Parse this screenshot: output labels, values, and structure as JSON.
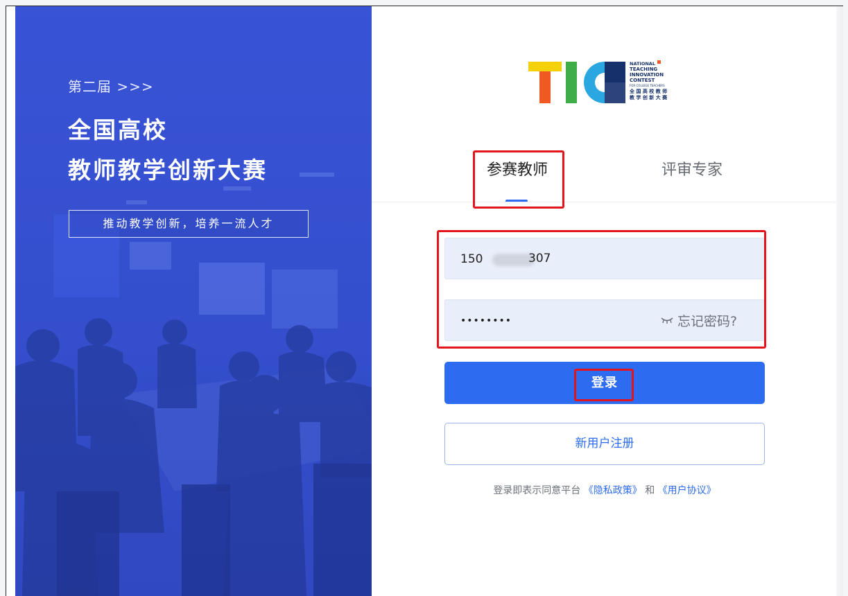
{
  "banner": {
    "edition": "第二届 >>>",
    "headline_line1": "全国高校",
    "headline_line2": "教师教学创新大赛",
    "slogan": "推动教学创新，培养一流人才"
  },
  "logo": {
    "lines": [
      "NATIONAL",
      "TEACHING",
      "INNOVATION",
      "CONTEST",
      "FOR COLLEGE TEACHERS",
      "全 国 高 校 教 师",
      "教 学 创 新 大 赛"
    ],
    "colors": {
      "yellow": "#f5d10a",
      "orange": "#ef5a23",
      "green": "#3fae49",
      "cyan": "#2aa6e0",
      "navy": "#15306a"
    }
  },
  "tabs": [
    {
      "label": "参赛教师",
      "active": true
    },
    {
      "label": "评审专家",
      "active": false
    }
  ],
  "form": {
    "phone_prefix": "150",
    "phone_suffix": "307",
    "password_mask": "••••••••",
    "eye_icon": "eye-closed-icon",
    "forgot_label": "忘记密码?"
  },
  "buttons": {
    "login": "登录",
    "register": "新用户注册"
  },
  "agreement": {
    "prefix": "登录即表示同意平台",
    "privacy": "《隐私政策》",
    "and": "和",
    "terms": "《用户协议》"
  },
  "colors": {
    "primary": "#2d6cf0",
    "highlight": "#e3141b",
    "banner": "#3650d0",
    "field_bg": "#e9eefb"
  }
}
